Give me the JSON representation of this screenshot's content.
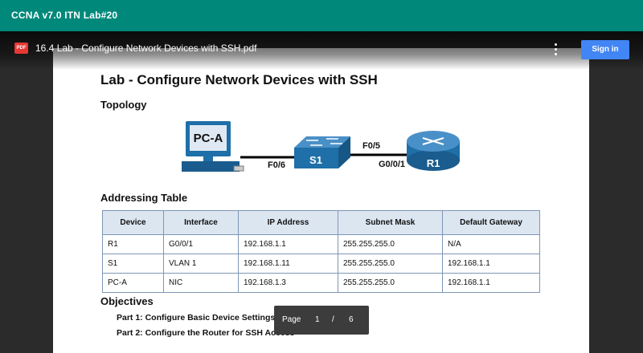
{
  "app": {
    "title": "CCNA v7.0 ITN Lab#20"
  },
  "viewer": {
    "file_icon": "pdf-icon",
    "file_icon_text": "PDF",
    "file_name": "16.4 Lab - Configure Network Devices with SSH.pdf",
    "menu_icon": "more-vert-icon",
    "sign_in_label": "Sign in"
  },
  "document": {
    "title": "Lab - Configure Network Devices with SSH",
    "topology_heading": "Topology",
    "topology": {
      "pc_label": "PC-A",
      "switch_label": "S1",
      "router_label": "R1",
      "link1_port": "F0/6",
      "link2_port_switch": "F0/5",
      "link2_port_router": "G0/0/1"
    },
    "addressing_heading": "Addressing Table",
    "table": {
      "headers": [
        "Device",
        "Interface",
        "IP Address",
        "Subnet Mask",
        "Default Gateway"
      ],
      "rows": [
        [
          "R1",
          "G0/0/1",
          "192.168.1.1",
          "255.255.255.0",
          "N/A"
        ],
        [
          "S1",
          "VLAN 1",
          "192.168.1.11",
          "255.255.255.0",
          "192.168.1.1"
        ],
        [
          "PC-A",
          "NIC",
          "192.168.1.3",
          "255.255.255.0",
          "192.168.1.1"
        ]
      ]
    },
    "objectives_heading": "Objectives",
    "objectives": [
      "Part 1: Configure Basic Device Settings",
      "Part 2: Configure the Router for SSH Access"
    ]
  },
  "pager": {
    "label": "Page",
    "current": "1",
    "separator": "/",
    "total": "6"
  },
  "colors": {
    "top_bar": "#00897b",
    "sign_in": "#4285f4",
    "table_header": "#dce6f1",
    "device_blue": "#1f6fa8"
  }
}
